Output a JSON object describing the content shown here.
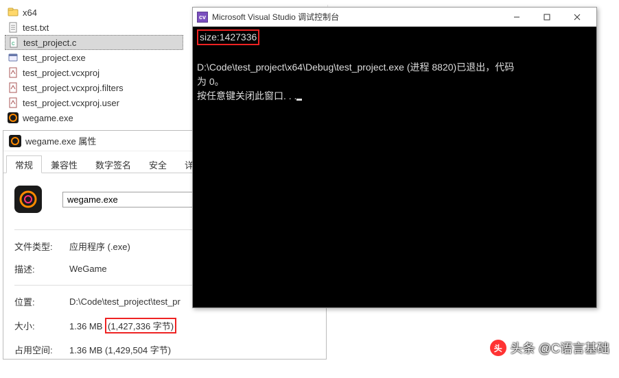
{
  "file_list": {
    "items": [
      {
        "label": "x64",
        "icon": "folder"
      },
      {
        "label": "test.txt",
        "icon": "txt"
      },
      {
        "label": "test_project.c",
        "icon": "c",
        "selected": true
      },
      {
        "label": "test_project.exe",
        "icon": "exe"
      },
      {
        "label": "test_project.vcxproj",
        "icon": "vcxproj"
      },
      {
        "label": "test_project.vcxproj.filters",
        "icon": "vcxproj"
      },
      {
        "label": "test_project.vcxproj.user",
        "icon": "vcxproj"
      },
      {
        "label": "wegame.exe",
        "icon": "wegame"
      }
    ]
  },
  "props": {
    "title": "wegame.exe 属性",
    "tabs": [
      "常规",
      "兼容性",
      "数字签名",
      "安全",
      "详细信息"
    ],
    "active_tab": 0,
    "exe_name": "wegame.exe",
    "rows": {
      "type_label": "文件类型:",
      "type_value": "应用程序 (.exe)",
      "desc_label": "描述:",
      "desc_value": "WeGame",
      "loc_label": "位置:",
      "loc_value": "D:\\Code\\test_project\\test_pr",
      "size_label": "大小:",
      "size_value_prefix": "1.36 MB ",
      "size_bytes": "(1,427,336 字节)",
      "disk_label": "占用空间:",
      "disk_value": "1.36 MB (1,429,504 字节)"
    }
  },
  "console": {
    "title": "Microsoft Visual Studio 调试控制台",
    "size_line": "size:1427336",
    "line2": "D:\\Code\\test_project\\x64\\Debug\\test_project.exe (进程 8820)已退出，代码\n为 0。",
    "line3": "按任意键关闭此窗口. . ."
  },
  "watermark": {
    "text": "头条 @C语言基础"
  }
}
